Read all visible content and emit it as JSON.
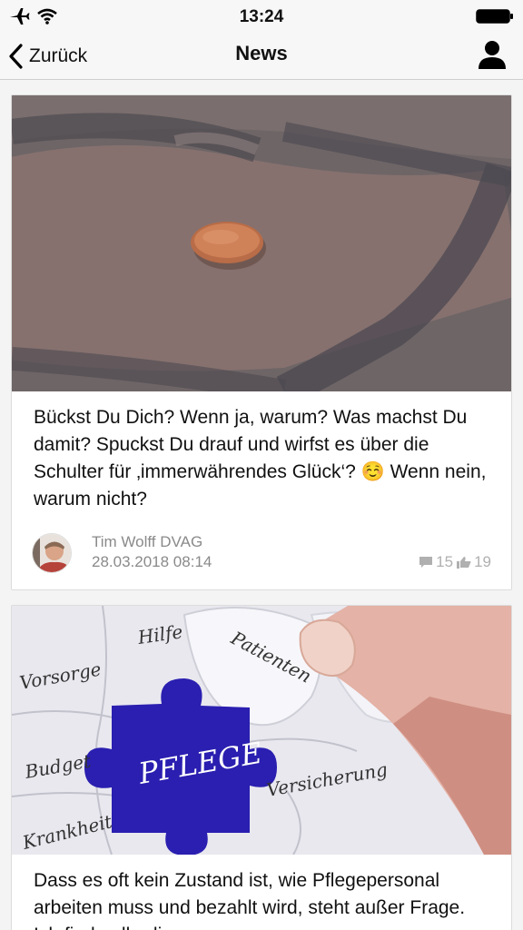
{
  "status": {
    "time": "13:24"
  },
  "nav": {
    "back_label": "Zurück",
    "title": "News"
  },
  "posts": [
    {
      "text": "Bückst Du Dich? Wenn ja, warum? Was machst Du damit? Spuckst Du drauf und wirfst es über die Schulter für ‚immerwährendes Glück‘? ☺️ Wenn nein, warum nicht?",
      "author": "Tim Wolff DVAG",
      "date": "28.03.2018 08:14",
      "comments": "15",
      "likes": "19"
    },
    {
      "text": "Dass es oft kein Zustand ist, wie Pflegepersonal arbeiten muss und bezahlt wird, steht außer Frage. Ich finde allerdings",
      "image_words": [
        "Hilfe",
        "Patienten",
        "Vorsorge",
        "PFLEGE",
        "Budget",
        "Versicherung",
        "Krankheit"
      ]
    }
  ],
  "icons": {
    "status": [
      "airplane-icon",
      "wifi-icon",
      "battery-icon"
    ],
    "nav": [
      "chevron-left-icon",
      "person-icon"
    ],
    "stats": [
      "comment-icon",
      "thumbs-up-icon"
    ]
  },
  "colors": {
    "puzzle_blue": "#2a1fb0",
    "meta_gray": "#8a8a8a"
  }
}
